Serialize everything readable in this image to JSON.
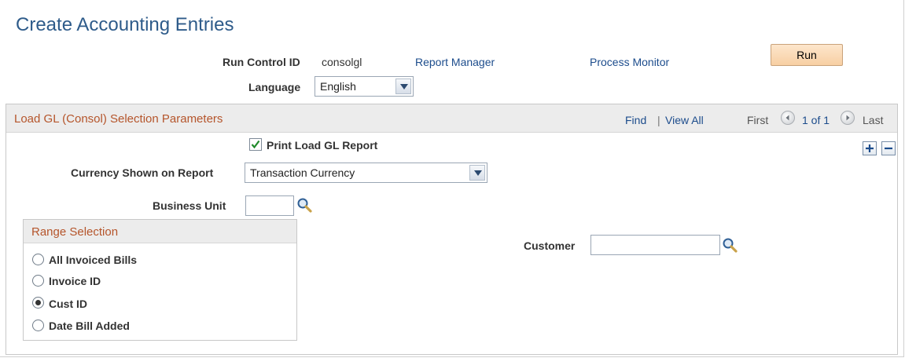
{
  "page": {
    "title": "Create Accounting Entries"
  },
  "run_control": {
    "label": "Run Control ID",
    "value": "consolgl",
    "report_manager": "Report Manager",
    "process_monitor": "Process Monitor",
    "run_label": "Run",
    "language_label": "Language",
    "language_value": "English"
  },
  "panel": {
    "title": "Load GL (Consol) Selection Parameters",
    "find": "Find",
    "sep": "|",
    "view_all": "View All",
    "first": "First",
    "count": "1 of 1",
    "last": "Last",
    "print_checkbox_label": "Print Load GL Report",
    "print_checked": true,
    "currency_label": "Currency Shown on Report",
    "currency_value": "Transaction Currency",
    "business_unit_label": "Business Unit",
    "business_unit_value": "",
    "customer_label": "Customer",
    "customer_value": ""
  },
  "range": {
    "title": "Range Selection",
    "options": [
      {
        "label": "All Invoiced Bills",
        "selected": false
      },
      {
        "label": "Invoice ID",
        "selected": false
      },
      {
        "label": "Cust ID",
        "selected": true
      },
      {
        "label": "Date Bill Added",
        "selected": false
      }
    ]
  },
  "colors": {
    "title_blue": "#2e5b8a",
    "link_blue": "#1c4c8c",
    "section_orange": "#b5552b",
    "run_button": "#f7cfa3"
  }
}
